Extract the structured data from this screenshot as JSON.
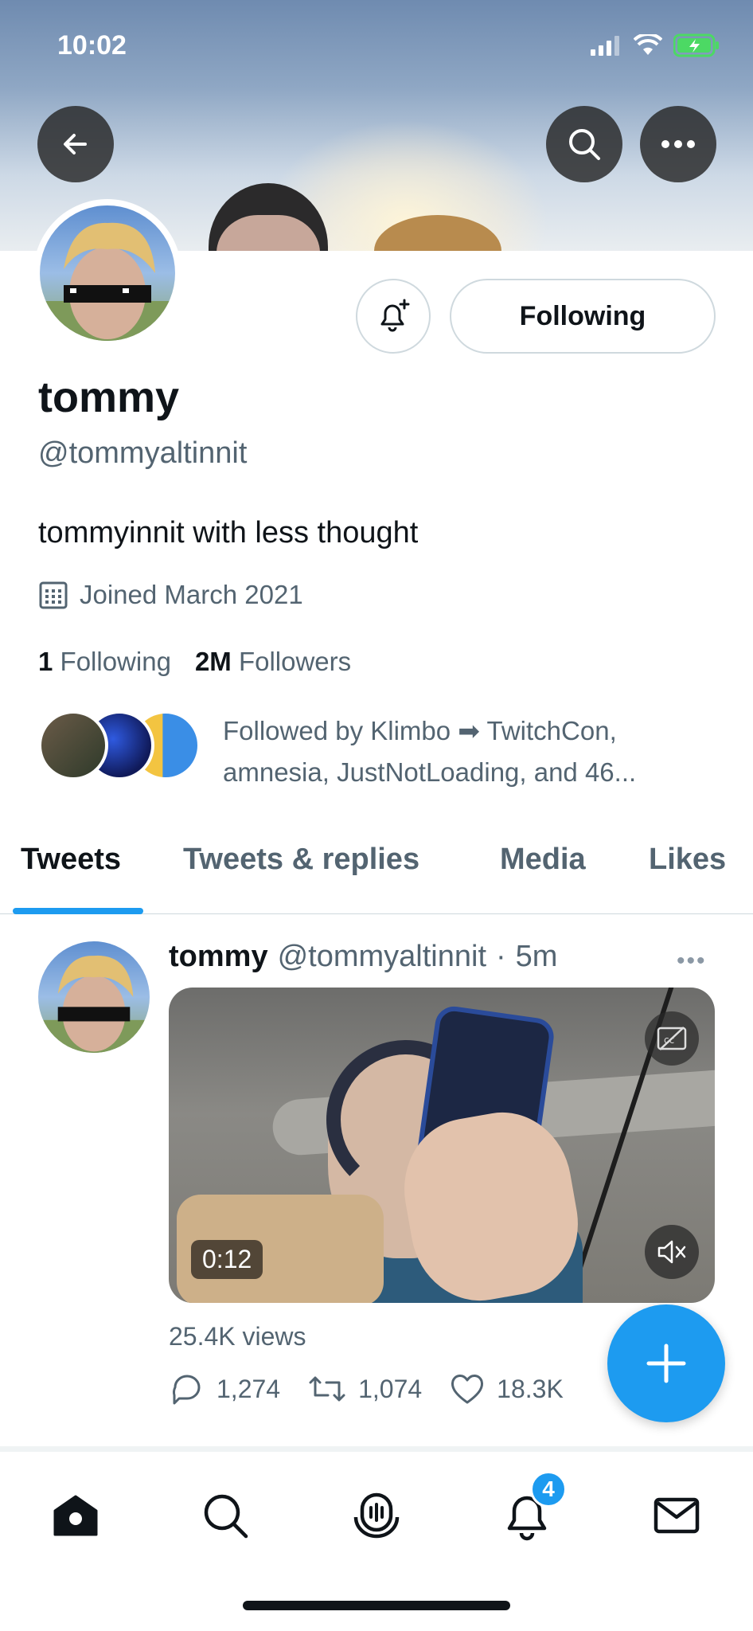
{
  "status_bar": {
    "time": "10:02"
  },
  "profile": {
    "name": "tommy",
    "handle": "@tommyaltinnit",
    "bio": "tommyinnit with less thought",
    "joined": "Joined March 2021",
    "following_count": "1",
    "following_label": "Following",
    "followers_count": "2M",
    "followers_label": "Followers",
    "followed_by_line1": "Followed by Klimbo ➡ TwitchCon,",
    "followed_by_line2": "amnesia, JustNotLoading, and 46..."
  },
  "actions": {
    "following_button": "Following"
  },
  "tabs": [
    {
      "label": "Tweets",
      "active": true
    },
    {
      "label": "Tweets & replies",
      "active": false
    },
    {
      "label": "Media",
      "active": false
    },
    {
      "label": "Likes",
      "active": false
    }
  ],
  "tweet": {
    "author": "tommy",
    "handle": "@tommyaltinnit",
    "separator": "·",
    "time": "5m",
    "more": "•••",
    "video_duration": "0:12",
    "views": "25.4K views",
    "replies": "1,274",
    "retweets": "1,074",
    "likes": "18.3K"
  },
  "bottom_nav": {
    "notifications_badge": "4"
  },
  "colors": {
    "accent": "#1d9bf0",
    "text": "#0f1419",
    "secondary": "#536471"
  }
}
